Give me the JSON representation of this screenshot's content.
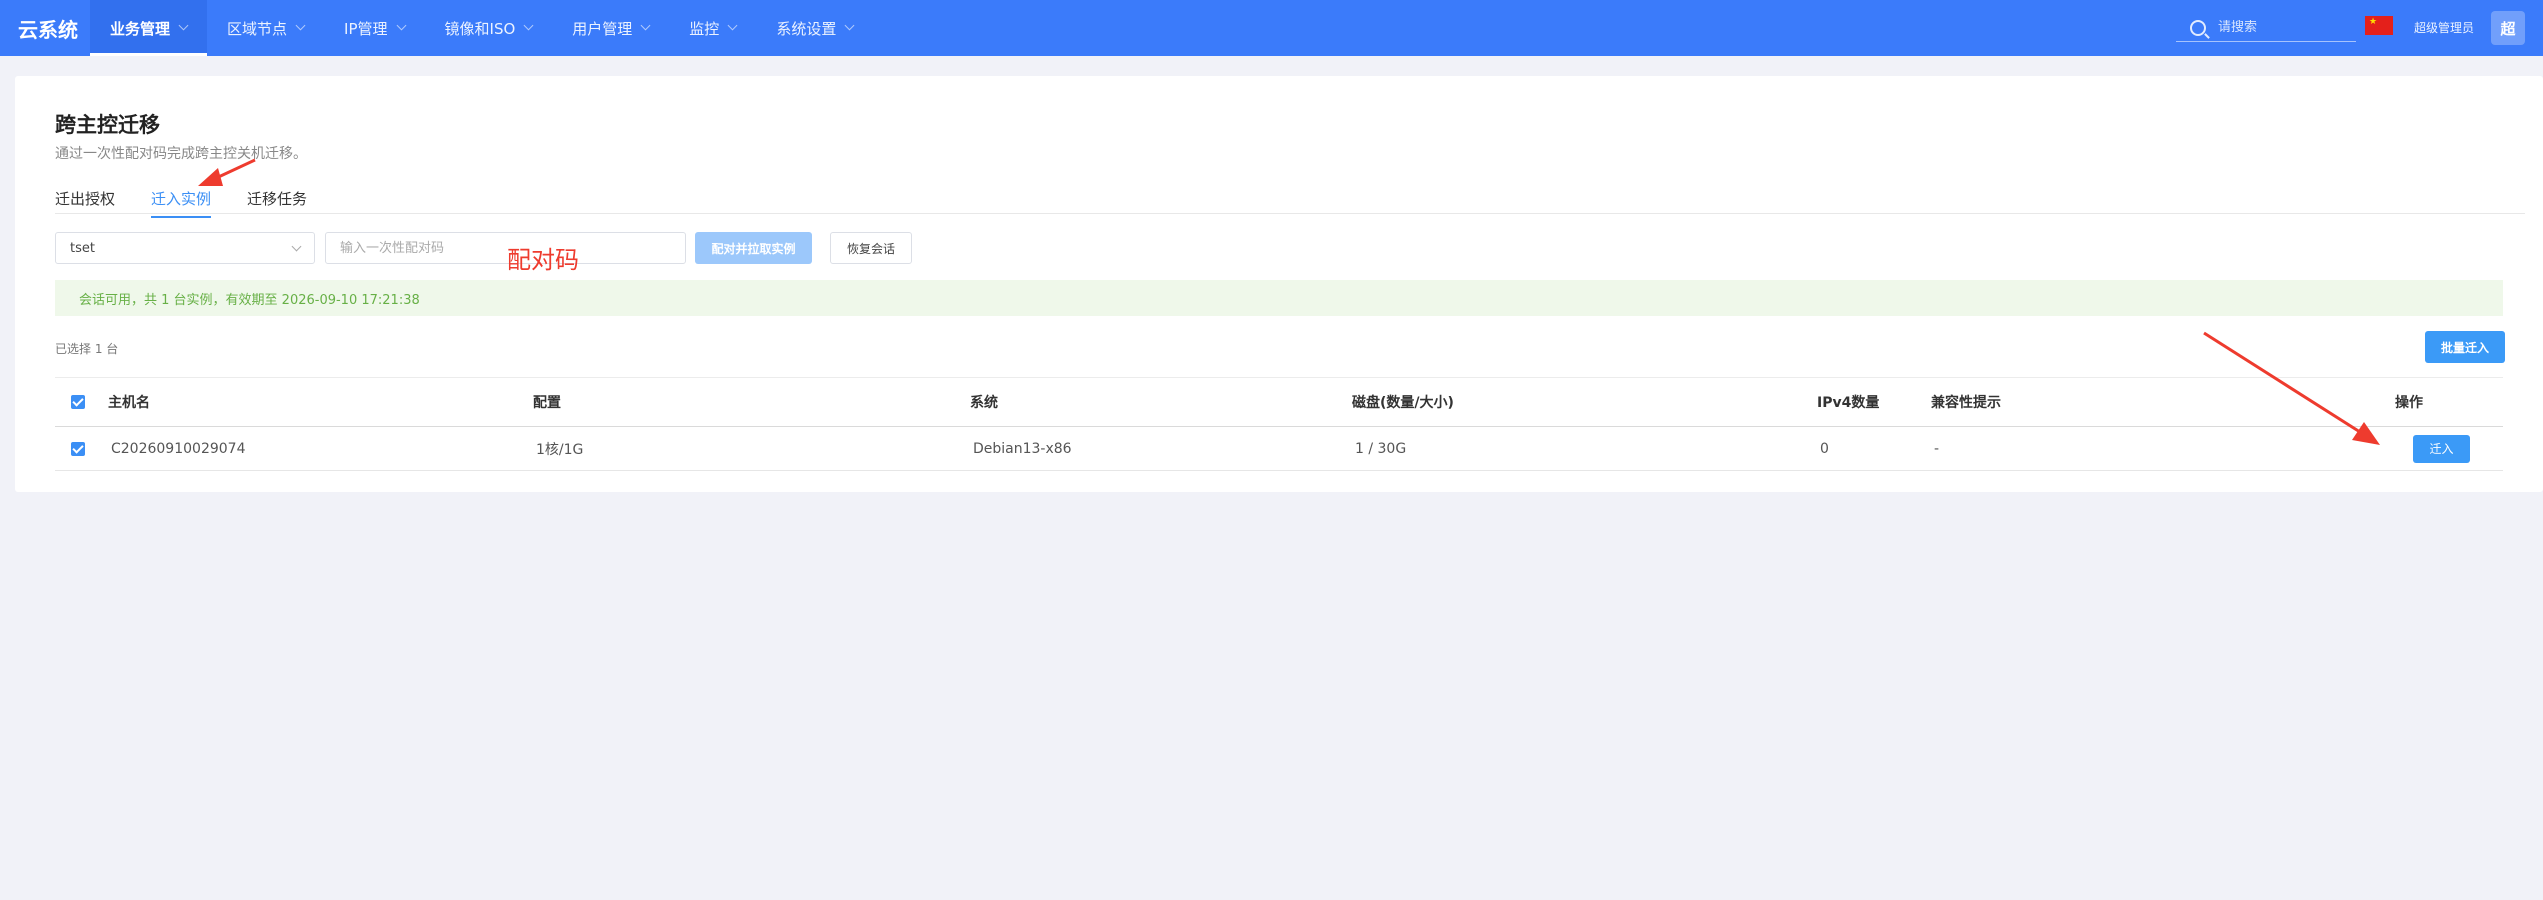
{
  "app": {
    "brand": "云系统"
  },
  "nav": {
    "items": [
      {
        "label": "业务管理"
      },
      {
        "label": "区域节点"
      },
      {
        "label": "IP管理"
      },
      {
        "label": "镜像和ISO"
      },
      {
        "label": "用户管理"
      },
      {
        "label": "监控"
      },
      {
        "label": "系统设置"
      }
    ],
    "active_index": 0
  },
  "header": {
    "search_placeholder": "请搜索",
    "user_name": "超级管理员",
    "avatar_text": "超"
  },
  "page": {
    "title": "跨主控迁移",
    "subtitle": "通过一次性配对码完成跨主控关机迁移。",
    "tabs": [
      {
        "label": "迁出授权"
      },
      {
        "label": "迁入实例"
      },
      {
        "label": "迁移任务"
      }
    ],
    "active_tab": 1
  },
  "form": {
    "select_value": "tset",
    "code_placeholder": "输入一次性配对码",
    "pair_button": "配对并拉取实例",
    "restore_button": "恢复会话"
  },
  "alert": {
    "text": "会话可用，共 1 台实例，有效期至 2026-09-10 17:21:38"
  },
  "selection": {
    "text": "已选择 1 台"
  },
  "batch_button": "批量迁入",
  "table": {
    "headers": {
      "hostname": "主机名",
      "config": "配置",
      "system": "系统",
      "disk": "磁盘(数量/大小)",
      "ipv4": "IPv4数量",
      "compat": "兼容性提示",
      "action": "操作"
    },
    "rows": [
      {
        "hostname": "C20260910029074",
        "config": "1核/1G",
        "system": "Debian13-x86",
        "disk": "1 / 30G",
        "ipv4": "0",
        "compat": "-",
        "action": "迁入",
        "checked": true
      }
    ]
  },
  "annotation": {
    "label": "配对码"
  },
  "colors": {
    "primary": "#3b7bfa",
    "button": "#3b9af7",
    "success_text": "#67b046",
    "annotation": "#ee3b2e"
  }
}
